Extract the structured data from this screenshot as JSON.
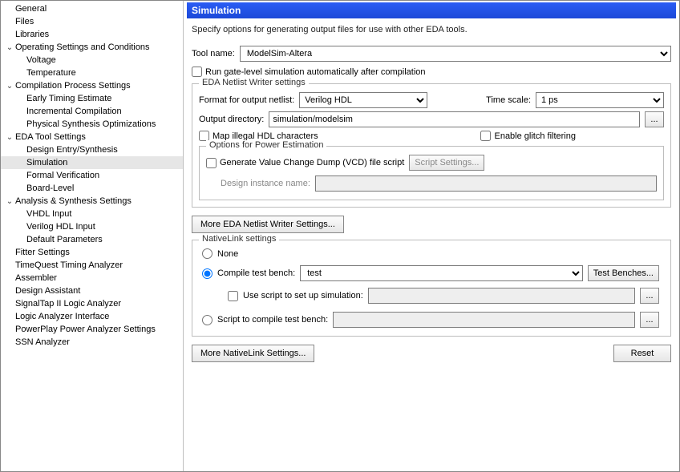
{
  "sidebar": {
    "items": [
      {
        "label": "General",
        "depth": 0,
        "exp": null,
        "sel": false
      },
      {
        "label": "Files",
        "depth": 0,
        "exp": null,
        "sel": false
      },
      {
        "label": "Libraries",
        "depth": 0,
        "exp": null,
        "sel": false
      },
      {
        "label": "Operating Settings and Conditions",
        "depth": 0,
        "exp": "open",
        "sel": false
      },
      {
        "label": "Voltage",
        "depth": 1,
        "exp": null,
        "sel": false
      },
      {
        "label": "Temperature",
        "depth": 1,
        "exp": null,
        "sel": false
      },
      {
        "label": "Compilation Process Settings",
        "depth": 0,
        "exp": "open",
        "sel": false
      },
      {
        "label": "Early Timing Estimate",
        "depth": 1,
        "exp": null,
        "sel": false
      },
      {
        "label": "Incremental Compilation",
        "depth": 1,
        "exp": null,
        "sel": false
      },
      {
        "label": "Physical Synthesis Optimizations",
        "depth": 1,
        "exp": null,
        "sel": false
      },
      {
        "label": "EDA Tool Settings",
        "depth": 0,
        "exp": "open",
        "sel": false
      },
      {
        "label": "Design Entry/Synthesis",
        "depth": 1,
        "exp": null,
        "sel": false
      },
      {
        "label": "Simulation",
        "depth": 1,
        "exp": null,
        "sel": true
      },
      {
        "label": "Formal Verification",
        "depth": 1,
        "exp": null,
        "sel": false
      },
      {
        "label": "Board-Level",
        "depth": 1,
        "exp": null,
        "sel": false
      },
      {
        "label": "Analysis & Synthesis Settings",
        "depth": 0,
        "exp": "open",
        "sel": false
      },
      {
        "label": "VHDL Input",
        "depth": 1,
        "exp": null,
        "sel": false
      },
      {
        "label": "Verilog HDL Input",
        "depth": 1,
        "exp": null,
        "sel": false
      },
      {
        "label": "Default Parameters",
        "depth": 1,
        "exp": null,
        "sel": false
      },
      {
        "label": "Fitter Settings",
        "depth": 0,
        "exp": null,
        "sel": false
      },
      {
        "label": "TimeQuest Timing Analyzer",
        "depth": 0,
        "exp": null,
        "sel": false
      },
      {
        "label": "Assembler",
        "depth": 0,
        "exp": null,
        "sel": false
      },
      {
        "label": "Design Assistant",
        "depth": 0,
        "exp": null,
        "sel": false
      },
      {
        "label": "SignalTap II Logic Analyzer",
        "depth": 0,
        "exp": null,
        "sel": false
      },
      {
        "label": "Logic Analyzer Interface",
        "depth": 0,
        "exp": null,
        "sel": false
      },
      {
        "label": "PowerPlay Power Analyzer Settings",
        "depth": 0,
        "exp": null,
        "sel": false
      },
      {
        "label": "SSN Analyzer",
        "depth": 0,
        "exp": null,
        "sel": false
      }
    ]
  },
  "panel": {
    "title": "Simulation",
    "description": "Specify options for generating output files for use with other EDA tools.",
    "tool_name_label": "Tool name:",
    "tool_name_value": "ModelSim-Altera",
    "run_gate_label": "Run gate-level simulation automatically after compilation",
    "netlist_group_title": "EDA Netlist Writer settings",
    "format_label": "Format for output netlist:",
    "format_value": "Verilog HDL",
    "timescale_label": "Time scale:",
    "timescale_value": "1 ps",
    "outdir_label": "Output directory:",
    "outdir_value": "simulation/modelsim",
    "browse_label": "...",
    "map_illegal_label": "Map illegal HDL characters",
    "enable_glitch_label": "Enable glitch filtering",
    "power_group_title": "Options for Power Estimation",
    "gen_vcd_label": "Generate Value Change Dump (VCD) file script",
    "script_settings_btn": "Script Settings...",
    "design_instance_label": "Design instance name:",
    "more_netlist_btn": "More EDA Netlist Writer Settings...",
    "nativelink_group_title": "NativeLink settings",
    "radio_none": "None",
    "radio_compile_tb": "Compile test bench:",
    "compile_tb_value": "test",
    "test_benches_btn": "Test Benches...",
    "use_script_label": "Use script to set up simulation:",
    "radio_script_compile": "Script to compile test bench:",
    "more_nativelink_btn": "More NativeLink Settings...",
    "reset_btn": "Reset"
  }
}
